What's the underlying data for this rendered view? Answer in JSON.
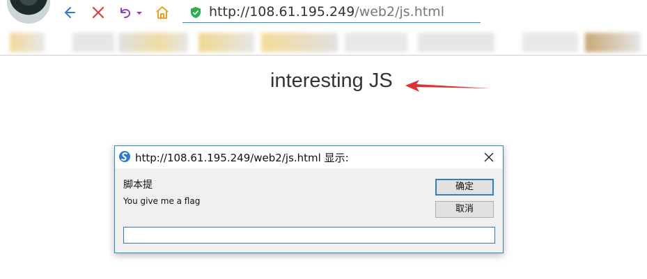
{
  "browser": {
    "url_host": "http://108.61.195.249",
    "url_path": "/web2/js.html",
    "icons": [
      "back-icon",
      "stop-icon",
      "undo-icon",
      "home-icon",
      "shield-icon"
    ],
    "bookmarks_blurred": true
  },
  "page": {
    "heading": "interesting JS",
    "arrow_color": "#e03030"
  },
  "dialog": {
    "title": "http://108.61.195.249/web2/js.html 显示:",
    "label": "脚本提",
    "message": "You give me a flag",
    "ok_label": "确定",
    "cancel_label": "取消",
    "input_value": ""
  },
  "colors": {
    "accent": "#2b88b8",
    "urlbar_underline": "#1e90c8",
    "shield_green": "#2cae4c",
    "home_orange": "#f0a020",
    "undo_purple": "#8a3fd0",
    "stop_red": "#e03a3a",
    "back_blue": "#2d7ad6"
  }
}
